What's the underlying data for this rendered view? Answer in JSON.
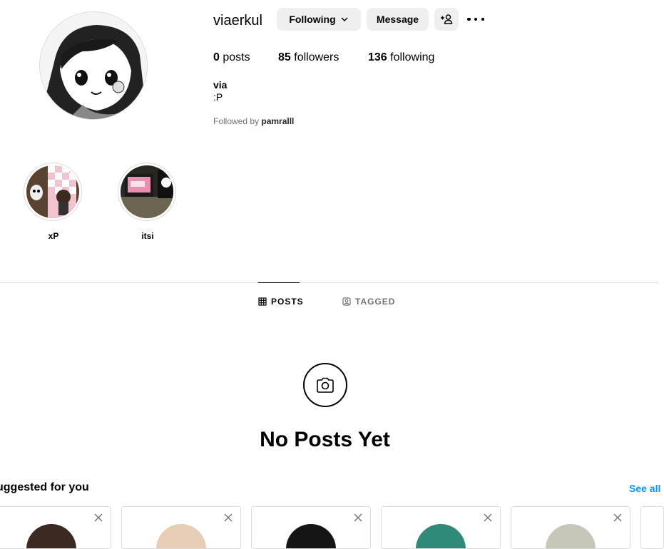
{
  "profile": {
    "username": "viaerkul",
    "following_label": "Following",
    "message_label": "Message",
    "posts_count": "0",
    "posts_label": "posts",
    "followers_count": "85",
    "followers_label": "followers",
    "following_count": "136",
    "following_count_label": "following",
    "full_name": "via",
    "bio": ":P",
    "followed_by_prefix": "Followed by",
    "followed_by_user": "pamralll"
  },
  "highlights": [
    {
      "label": "xP"
    },
    {
      "label": "itsi"
    }
  ],
  "tabs": {
    "posts": "POSTS",
    "tagged": "TAGGED"
  },
  "empty_state": {
    "title": "No Posts Yet"
  },
  "suggested": {
    "title": "uggested for you",
    "see_all": "See all"
  },
  "icons": {
    "chevron": "chevron-down-icon",
    "add_user": "add-user-icon",
    "more": "more-options-icon",
    "grid": "grid-icon",
    "tag": "tag-icon",
    "camera": "camera-icon",
    "close": "close-icon"
  },
  "colors": {
    "link_blue": "#0095f6",
    "button_gray": "#efefef",
    "border": "#dbdbdb",
    "muted": "#737373"
  }
}
